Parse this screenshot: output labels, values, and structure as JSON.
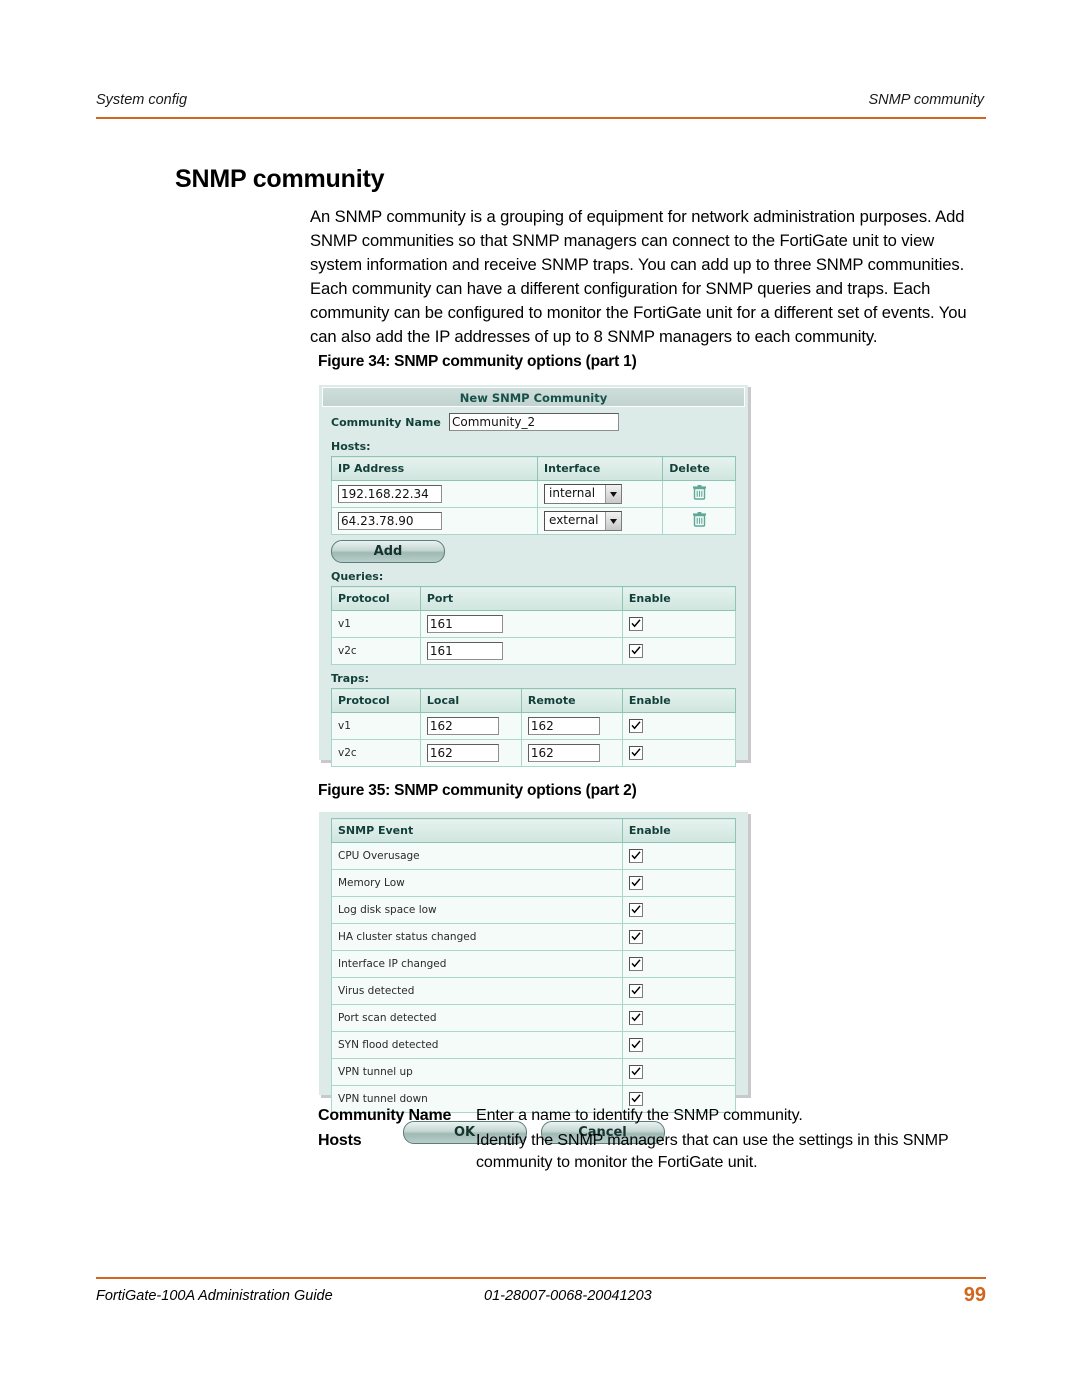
{
  "header": {
    "left": "System config",
    "right": "SNMP community",
    "rule_color": "#d2661e"
  },
  "page_title": "SNMP community",
  "body_paragraph": "An SNMP community is a grouping of equipment for network administration purposes. Add SNMP communities so that SNMP managers can connect to the FortiGate unit to view system information and receive SNMP traps. You can add up to three SNMP communities. Each community can have a different configuration for SNMP queries and traps. Each community can be configured to monitor the FortiGate unit for a different set of events. You can also add the IP addresses of up to 8 SNMP managers to each community.",
  "figure34": {
    "caption": "Figure 34: SNMP community options (part 1)",
    "dialog_title": "New SNMP Community",
    "community_name_label": "Community Name",
    "community_name_value": "Community_2",
    "hosts_label": "Hosts:",
    "hosts_headers": [
      "IP Address",
      "Interface",
      "Delete"
    ],
    "hosts_rows": [
      {
        "ip": "192.168.22.34",
        "interface": "internal",
        "delete_icon": "trash-icon"
      },
      {
        "ip": "64.23.78.90",
        "interface": "external",
        "delete_icon": "trash-icon"
      }
    ],
    "add_button_label": "Add",
    "queries_label": "Queries:",
    "queries_headers": [
      "Protocol",
      "Port",
      "Enable"
    ],
    "queries_rows": [
      {
        "protocol": "v1",
        "port": "161",
        "enabled": true
      },
      {
        "protocol": "v2c",
        "port": "161",
        "enabled": true
      }
    ],
    "traps_label": "Traps:",
    "traps_headers": [
      "Protocol",
      "Local",
      "Remote",
      "Enable"
    ],
    "traps_rows": [
      {
        "protocol": "v1",
        "local": "162",
        "remote": "162",
        "enabled": true
      },
      {
        "protocol": "v2c",
        "local": "162",
        "remote": "162",
        "enabled": true
      }
    ]
  },
  "figure35": {
    "caption": "Figure 35: SNMP community options (part 2)",
    "event_headers": [
      "SNMP Event",
      "Enable"
    ],
    "event_rows": [
      {
        "event": "CPU Overusage",
        "enabled": true
      },
      {
        "event": "Memory Low",
        "enabled": true
      },
      {
        "event": "Log disk space low",
        "enabled": true
      },
      {
        "event": "HA cluster status changed",
        "enabled": true
      },
      {
        "event": "Interface IP changed",
        "enabled": true
      },
      {
        "event": "Virus detected",
        "enabled": true
      },
      {
        "event": "Port scan detected",
        "enabled": true
      },
      {
        "event": "SYN flood detected",
        "enabled": true
      },
      {
        "event": "VPN tunnel up",
        "enabled": true
      },
      {
        "event": "VPN tunnel down",
        "enabled": true
      }
    ],
    "ok_button_label": "OK",
    "cancel_button_label": "Cancel"
  },
  "definitions": [
    {
      "term": "Community Name",
      "description": "Enter a name to identify the SNMP community."
    },
    {
      "term": "Hosts",
      "description": "Identify the SNMP managers that can use the settings in this SNMP community to monitor the FortiGate unit."
    }
  ],
  "footer": {
    "guide": "FortiGate-100A Administration Guide",
    "document_id": "01-28007-0068-20041203",
    "page_number": "99"
  }
}
